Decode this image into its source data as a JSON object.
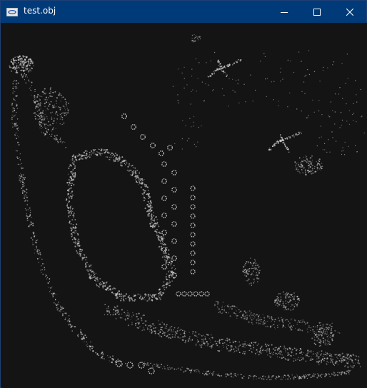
{
  "window": {
    "title": "test.obj",
    "app_icon": "3d-viewer-icon",
    "controls": {
      "minimize_icon": "minimize-icon",
      "maximize_icon": "maximize-icon",
      "close_icon": "close-icon"
    }
  },
  "viewport": {
    "content": "point-cloud-render",
    "background_color": "#141414",
    "point_color": "#d0d0d0",
    "titlebar_color": "#003a78"
  }
}
